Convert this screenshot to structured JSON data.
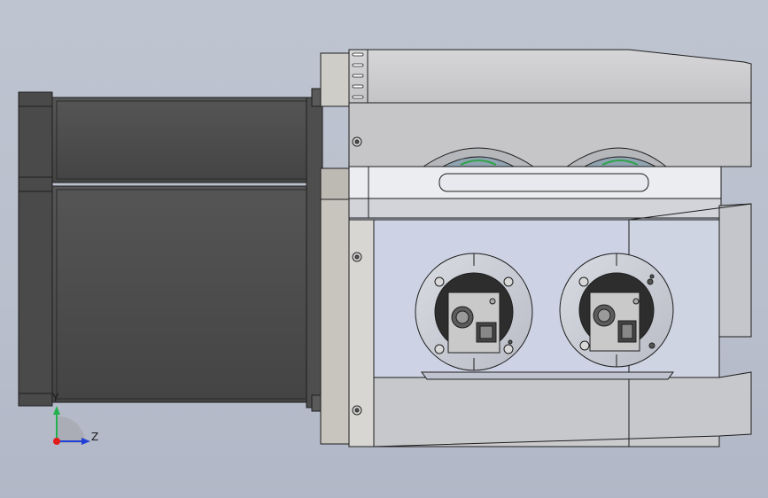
{
  "viewport": {
    "background_top": "#bfc4d1",
    "background_bottom": "#b1b7c6"
  },
  "triad": {
    "y_label": "Y",
    "z_label": "Z",
    "y_color": "#22b14c",
    "z_color": "#1f3fd6",
    "origin_color": "#e21b1b"
  },
  "colors": {
    "motor_body": "#4b4b4b",
    "housing": "#c9c9cb",
    "panel": "#cdd3e4",
    "edge": "#1e1e1e"
  }
}
